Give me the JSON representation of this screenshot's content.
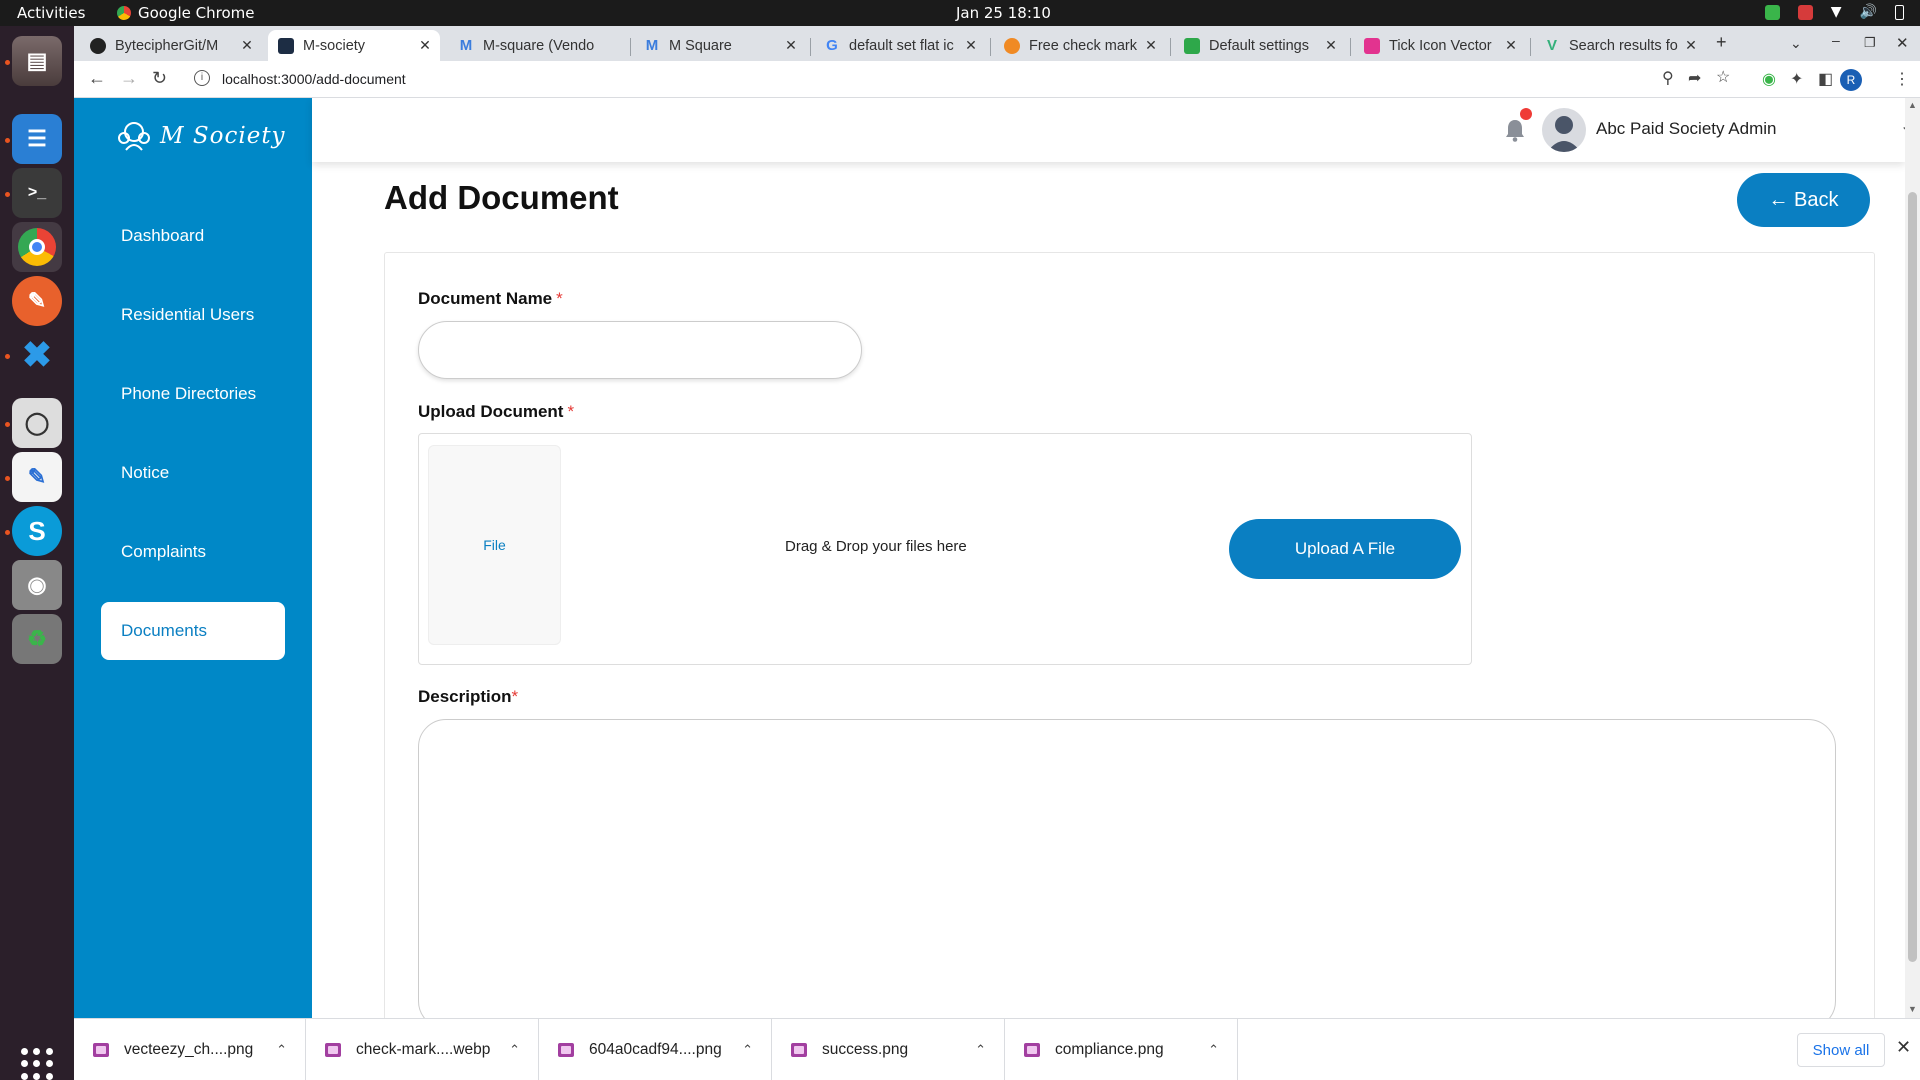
{
  "os": {
    "activities": "Activities",
    "app_name": "Google Chrome",
    "clock": "Jan 25  18:10"
  },
  "browser": {
    "tabs": [
      {
        "title": "BytecipherGit/M",
        "icon": "github-icon"
      },
      {
        "title": "M-society",
        "icon": "msociety-icon",
        "active": true
      },
      {
        "title": "M-square (Vendo",
        "icon": "m-logo-icon"
      },
      {
        "title": "M Square",
        "icon": "m-logo-icon"
      },
      {
        "title": "default set flat ic",
        "icon": "google-icon"
      },
      {
        "title": "Free check mark",
        "icon": "orange-site-icon"
      },
      {
        "title": "Default settings",
        "icon": "green-site-icon"
      },
      {
        "title": "Tick Icon Vector",
        "icon": "pink-site-icon"
      },
      {
        "title": "Search results fo",
        "icon": "vecteezy-icon"
      }
    ],
    "url": "localhost:3000/add-document",
    "profile_initial": "R"
  },
  "app": {
    "brand": "M Society",
    "nav": [
      {
        "label": "Dashboard"
      },
      {
        "label": "Residential Users"
      },
      {
        "label": "Phone Directories"
      },
      {
        "label": "Notice"
      },
      {
        "label": "Complaints"
      },
      {
        "label": "Documents",
        "active": true
      }
    ],
    "user_name": "Abc Paid Society Admin",
    "page_title": "Add Document",
    "back_label": "← Back",
    "form": {
      "document_name_label": "Document Name",
      "upload_label": "Upload Document",
      "description_label": "Description",
      "required_mark": "*",
      "file_label": "File",
      "drag_drop_text": "Drag & Drop your files here",
      "upload_button": "Upload A File",
      "document_name_value": "",
      "description_value": ""
    }
  },
  "downloads": {
    "items": [
      {
        "name": "vecteezy_ch....png"
      },
      {
        "name": "check-mark....webp"
      },
      {
        "name": "604a0cadf94....png"
      },
      {
        "name": "success.png"
      },
      {
        "name": "compliance.png"
      }
    ],
    "show_all": "Show all"
  },
  "colors": {
    "sidebar": "#0088c7",
    "primary": "#0a7fc2",
    "required": "#e53935",
    "notification_dot": "#ef3b36"
  }
}
